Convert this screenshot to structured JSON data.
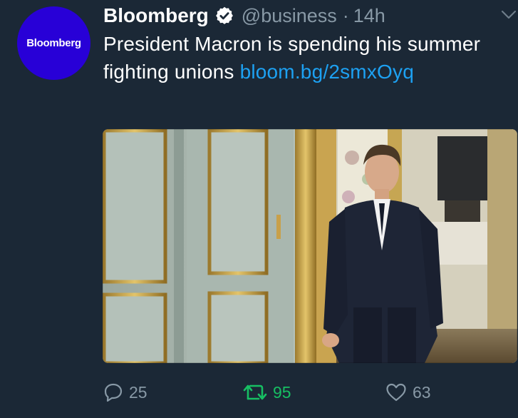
{
  "tweet": {
    "avatar_text": "Bloomberg",
    "name": "Bloomberg",
    "handle": "@business",
    "separator": "·",
    "time": "14h",
    "text": "President Macron is spending his summer fighting unions ",
    "link": "bloom.bg/2smxOyq",
    "media_alt": "Photo of President Macron walking through an ornate doorway",
    "actions": {
      "reply_count": "25",
      "retweet_count": "95",
      "like_count": "63",
      "retweeted": true
    }
  },
  "colors": {
    "background": "#1b2836",
    "avatar": "#2800d7",
    "link": "#1da1f2",
    "muted": "#8899a6",
    "retweet_active": "#17bf63"
  },
  "icons": [
    "verified-badge-icon",
    "caret-down-icon",
    "reply-icon",
    "retweet-icon",
    "like-icon"
  ]
}
